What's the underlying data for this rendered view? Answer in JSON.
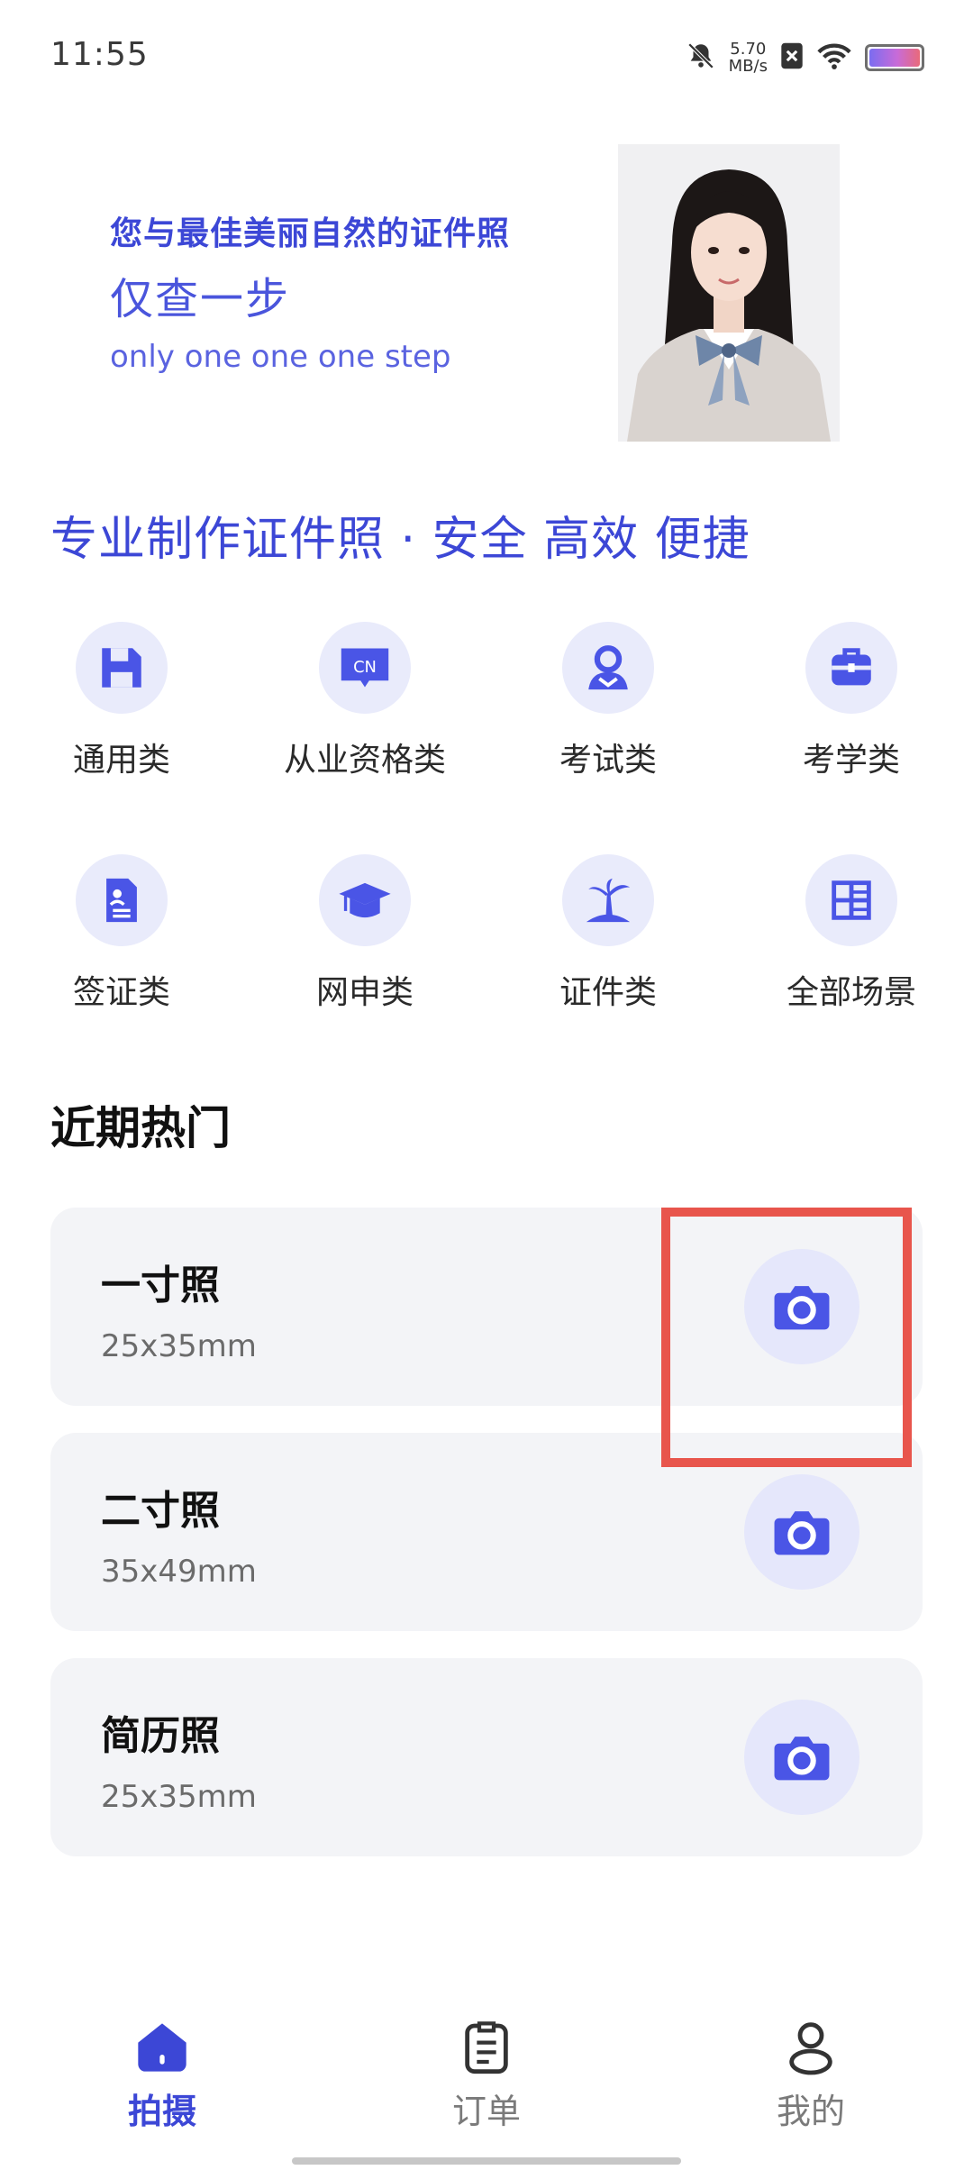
{
  "status_bar": {
    "time": "11:55",
    "net_speed_value": "5.70",
    "net_speed_unit": "MB/s"
  },
  "banner": {
    "slogan": "您与最佳美丽自然的证件照",
    "subtitle": "仅查一步",
    "english": "only one one one step"
  },
  "headline": "专业制作证件照 · 安全 高效 便捷",
  "categories": [
    {
      "label": "通用类",
      "icon": "save-icon"
    },
    {
      "label": "从业资格类",
      "icon": "cn-badge-icon"
    },
    {
      "label": "考试类",
      "icon": "person-icon"
    },
    {
      "label": "考学类",
      "icon": "briefcase-icon"
    },
    {
      "label": "签证类",
      "icon": "document-icon"
    },
    {
      "label": "网申类",
      "icon": "graduation-cap-icon"
    },
    {
      "label": "证件类",
      "icon": "palm-tree-icon"
    },
    {
      "label": "全部场景",
      "icon": "grid-layout-icon"
    }
  ],
  "cn_badge_text": "CN",
  "recent": {
    "title": "近期热门",
    "items": [
      {
        "name": "一寸照",
        "size": "25x35mm"
      },
      {
        "name": "二寸照",
        "size": "35x49mm"
      },
      {
        "name": "简历照",
        "size": "25x35mm"
      }
    ]
  },
  "bottom_nav": [
    {
      "label": "拍摄",
      "icon": "home-icon",
      "active": true
    },
    {
      "label": "订单",
      "icon": "order-icon",
      "active": false
    },
    {
      "label": "我的",
      "icon": "user-icon",
      "active": false
    }
  ],
  "colors": {
    "accent": "#3c47d6",
    "icon_blue": "#4a55e6",
    "icon_bg": "#e9ebfb",
    "card_bg": "#f3f4f7",
    "highlight": "#e8554c"
  }
}
